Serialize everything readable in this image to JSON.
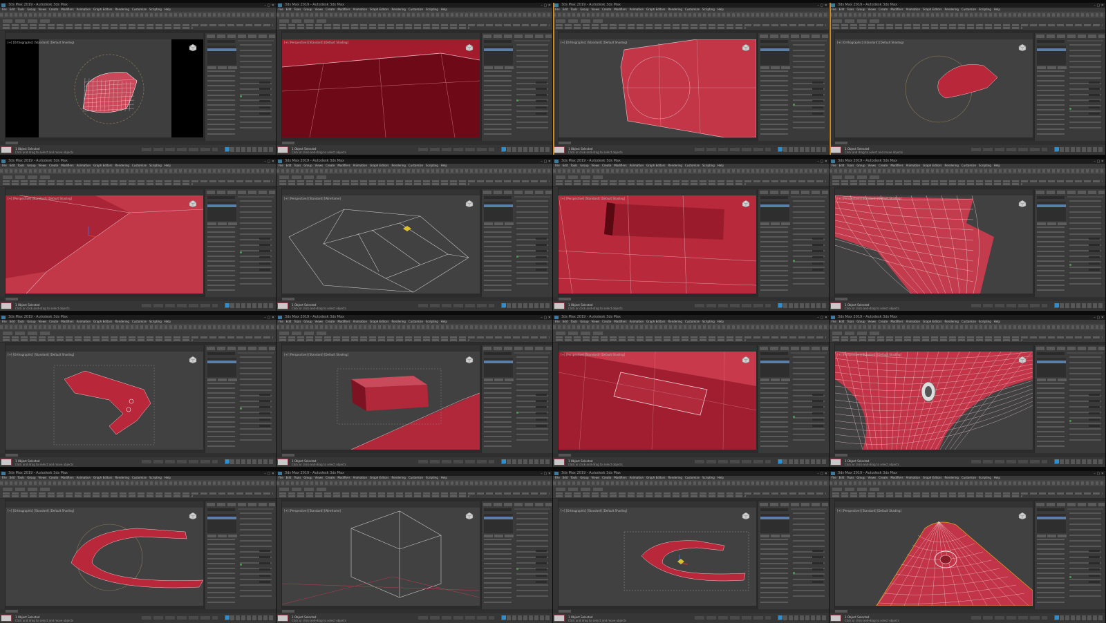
{
  "app": {
    "title": "3ds Max 2019 - Autodesk 3ds Max",
    "menu": [
      "File",
      "Edit",
      "Tools",
      "Group",
      "Views",
      "Create",
      "Modifiers",
      "Animation",
      "Graph Editors",
      "Rendering",
      "Customize",
      "Scripting",
      "Help"
    ],
    "window_controls": "–  ▢  ✕"
  },
  "panels": [
    {
      "viewport_label": "[+] [Orthographic] [Standard] [Default Shading]",
      "status_line1": "1 Object Selected",
      "status_line2": "Click and drag to select and move objects",
      "content": "cap-wireframe-dark"
    },
    {
      "viewport_label": "[+] [Perspective] [Standard] [Default Shading]",
      "status_line1": "1 Object Selected",
      "status_line2": "Click or click-and-drag to select objects",
      "content": "red-closeup-edges"
    },
    {
      "viewport_label": "[+] [Orthographic] [Standard] [Default Shading]",
      "status_line1": "1 Object Selected",
      "status_line2": "Click or click-and-drag to select objects",
      "content": "red-panel-circle"
    },
    {
      "viewport_label": "[+] [Orthographic] [Standard] [Default Shading]",
      "status_line1": "1 Object Selected",
      "status_line2": "Click and drag to select and move objects",
      "content": "small-curved-piece"
    },
    {
      "viewport_label": "[+] [Perspective] [Standard] [Default Shading]",
      "status_line1": "1 Object Selected",
      "status_line2": "Click or click-and-drag to select objects",
      "content": "red-bevel-gizmo"
    },
    {
      "viewport_label": "[+] [Perspective] [Standard] [Wireframe]",
      "status_line1": "1 Object Selected",
      "status_line2": "Click or click-and-drag to select objects",
      "content": "wireframe-lines"
    },
    {
      "viewport_label": "[+] [Perspective] [Standard] [Default Shading]",
      "status_line1": "1 Object Selected",
      "status_line2": "Click or click-and-drag to select objects",
      "content": "red-slot-hole"
    },
    {
      "viewport_label": "[+] [Perspective] [Standard] [Default Shading]",
      "status_line1": "1 Object Selected",
      "status_line2": "Click or click-and-drag to select objects",
      "content": "red-curved-grid"
    },
    {
      "viewport_label": "[+] [Orthographic] [Standard] [Default Shading]",
      "status_line1": "1 Object Selected",
      "status_line2": "Click and drag to select and move objects",
      "content": "red-hook-piece"
    },
    {
      "viewport_label": "[+] [Perspective] [Standard] [Default Shading]",
      "status_line1": "1 Object Selected",
      "status_line2": "Click or click-and-drag to select objects",
      "content": "red-box-and-ramp"
    },
    {
      "viewport_label": "[+] [Perspective] [Standard] [Default Shading]",
      "status_line1": "1 Object Selected",
      "status_line2": "Click or click-and-drag to select objects",
      "content": "red-surface-slot"
    },
    {
      "viewport_label": "[+] [Perspective] [Standard] [Default Shading]",
      "status_line1": "1 Object Selected",
      "status_line2": "Click or click-and-drag to select objects",
      "content": "red-dense-mesh-hole"
    },
    {
      "viewport_label": "[+] [Orthographic] [Standard] [Default Shading]",
      "status_line1": "1 Object Selected",
      "status_line2": "Click and drag to select and move objects",
      "content": "red-arc-piece"
    },
    {
      "viewport_label": "[+] [Perspective] [Standard] [Wireframe]",
      "status_line1": "1 Object Selected",
      "status_line2": "Click or click-and-drag to select objects",
      "content": "wireframe-box"
    },
    {
      "viewport_label": "[+] [Orthographic] [Standard] [Default Shading]",
      "status_line1": "1 Object Selected",
      "status_line2": "Click and drag to select and move objects",
      "content": "red-arc-gizmo"
    },
    {
      "viewport_label": "[+] [Perspective] [Standard] [Default Shading]",
      "status_line1": "1 Object Selected",
      "status_line2": "Click or click-and-drag to select objects",
      "content": "red-peak-hole"
    }
  ],
  "colors": {
    "mesh_red": "#b8283a",
    "mesh_dark_red": "#6e0a18",
    "viewport_bg": "#414141",
    "ui_dark": "#2b2b2b",
    "accent_orange": "#d08a1e",
    "select_blue": "#5b7fa6"
  },
  "icons": [
    "app-icon",
    "nav-cube-icon",
    "window-controls-icon",
    "maxscript-icon",
    "key-icon"
  ]
}
